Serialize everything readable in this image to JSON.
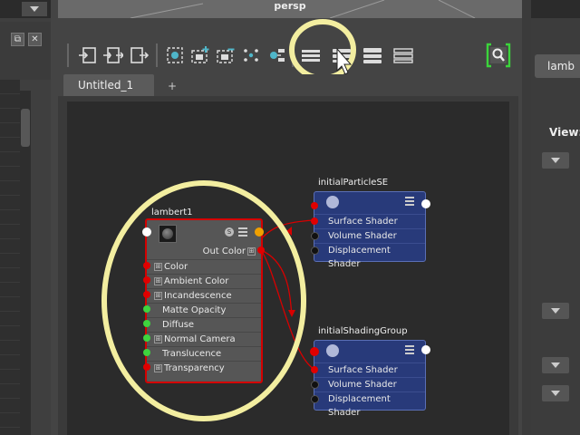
{
  "viewport": {
    "camera_label": "persp"
  },
  "left_panel": {
    "menu_icon": "chevron-down-icon",
    "buttons": [
      "⧉",
      "✕"
    ]
  },
  "toolbar": {
    "icons": [
      "input-connections-icon",
      "input-output-connections-icon",
      "output-connections-icon",
      "select-object-icon",
      "add-selected-icon",
      "remove-selected-icon",
      "layout-icon",
      "graph-highlight-icon",
      "simple-mode-icon",
      "connected-mode-icon",
      "full-mode-icon",
      "custom-mode-icon",
      "search-icon"
    ]
  },
  "tabs": {
    "active": "Untitled_1",
    "add_label": "+"
  },
  "nodes": {
    "lambert": {
      "title": "lambert1",
      "out_label": "Out Color",
      "attributes": [
        {
          "label": "Color",
          "plus": true,
          "port": "red"
        },
        {
          "label": "Ambient Color",
          "plus": true,
          "port": "red"
        },
        {
          "label": "Incandescence",
          "plus": true,
          "port": "red"
        },
        {
          "label": "Matte Opacity",
          "plus": false,
          "port": "green"
        },
        {
          "label": "Diffuse",
          "plus": false,
          "port": "green"
        },
        {
          "label": "Normal Camera",
          "plus": true,
          "port": "green"
        },
        {
          "label": "Translucence",
          "plus": false,
          "port": "green"
        },
        {
          "label": "Transparency",
          "plus": true,
          "port": "red"
        }
      ]
    },
    "particle_se": {
      "title": "initialParticleSE",
      "rows": [
        "Surface Shader",
        "Volume Shader",
        "Displacement Shader"
      ]
    },
    "shading_group": {
      "title": "initialShadingGroup",
      "rows": [
        "Surface Shader",
        "Volume Shader",
        "Displacement Shader"
      ]
    }
  },
  "right_panel": {
    "tab_label": "lamb",
    "view_label": "View:"
  },
  "colors": {
    "highlight": "#f3eea0",
    "connection": "#d80000",
    "node_blue": "#283a7a",
    "node_border_selected": "#d40000"
  }
}
